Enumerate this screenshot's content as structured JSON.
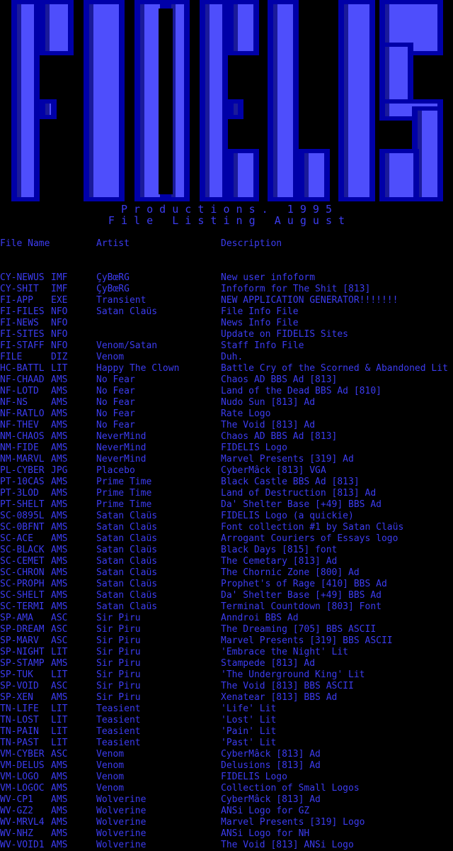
{
  "logo": {
    "text": "FIDELIS",
    "colors": {
      "fill": "#4e4efc",
      "shade": "#1a1a9a",
      "outline": "#0000a8"
    }
  },
  "tagline1": "P r o d u c t i o n s .   1 9 9 5",
  "tagline2": "F i l e   L i s t i n g   A u g u s t",
  "headers": {
    "name": "File Name",
    "artist": "Artist",
    "description": "Description"
  },
  "colors": {
    "text": "#3c3cf0",
    "background": "#000000"
  },
  "files": [
    {
      "name": "CY-NEWUS",
      "ext": "IMF",
      "artist": "ÇyBœRG",
      "desc": "New user infoform"
    },
    {
      "name": "CY-SHIT",
      "ext": "IMF",
      "artist": "ÇyBœRG",
      "desc": "Infoform for The Shit [813]"
    },
    {
      "name": "FI-APP",
      "ext": "EXE",
      "artist": "Transient",
      "desc": "NEW APPLICATION GENERATOR!!!!!!!"
    },
    {
      "name": "FI-FILES",
      "ext": "NFO",
      "artist": "Satan Claüs",
      "desc": "File Info File"
    },
    {
      "name": "FI-NEWS",
      "ext": "NFO",
      "artist": "",
      "desc": "News Info File"
    },
    {
      "name": "FI-SITES",
      "ext": "NFO",
      "artist": "",
      "desc": "Update on FIDELIS Sites"
    },
    {
      "name": "FI-STAFF",
      "ext": "NFO",
      "artist": "Venom/Satan",
      "desc": "Staff Info File"
    },
    {
      "name": "FILE",
      "ext": "DIZ",
      "artist": "Venom",
      "desc": "Duh."
    },
    {
      "name": "HC-BATTL",
      "ext": "LIT",
      "artist": "Happy The Clown",
      "desc": "Battle Cry of the Scorned & Abandoned Lit"
    },
    {
      "name": "NF-CHAAD",
      "ext": "AMS",
      "artist": "No Fear",
      "desc": "Chaos AD BBS Ad [813]"
    },
    {
      "name": "NF-LOTD",
      "ext": "AMS",
      "artist": "No Fear",
      "desc": "Land of the Dead BBS Ad [810]"
    },
    {
      "name": "NF-NS",
      "ext": "AMS",
      "artist": "No Fear",
      "desc": "Nudo Sun [813] Ad"
    },
    {
      "name": "NF-RATLO",
      "ext": "AMS",
      "artist": "No Fear",
      "desc": "Rate Logo"
    },
    {
      "name": "NF-THEV",
      "ext": "AMS",
      "artist": "No Fear",
      "desc": "The Void [813] Ad"
    },
    {
      "name": "NM-CHAOS",
      "ext": "AMS",
      "artist": "NeverMind",
      "desc": "Chaos AD BBS Ad [813]"
    },
    {
      "name": "NM-FIDE",
      "ext": "AMS",
      "artist": "NeverMind",
      "desc": "FIDELIS Logo"
    },
    {
      "name": "NM-MARVL",
      "ext": "AMS",
      "artist": "NeverMind",
      "desc": "Marvel Presents [319] Ad"
    },
    {
      "name": "PL-CYBER",
      "ext": "JPG",
      "artist": "Placebo",
      "desc": "CyberMâck [813] VGA"
    },
    {
      "name": "PT-10CAS",
      "ext": "AMS",
      "artist": "Prime Time",
      "desc": "Black Castle BBS Ad [813]"
    },
    {
      "name": "PT-3LOD",
      "ext": "AMS",
      "artist": "Prime Time",
      "desc": "Land of Destruction [813] Ad"
    },
    {
      "name": "PT-SHELT",
      "ext": "AMS",
      "artist": "Prime Time",
      "desc": "Da' Shelter Base [+49] BBS Ad"
    },
    {
      "name": "SC-0895L",
      "ext": "AMS",
      "artist": "Satan Claüs",
      "desc": "FIDELIS Logo (a quickie)"
    },
    {
      "name": "SC-0BFNT",
      "ext": "AMS",
      "artist": "Satan Claüs",
      "desc": "Font collection #1 by Satan Claüs"
    },
    {
      "name": "SC-ACE",
      "ext": "AMS",
      "artist": "Satan Claüs",
      "desc": "Arrogant Couriers of Essays logo"
    },
    {
      "name": "SC-BLACK",
      "ext": "AMS",
      "artist": "Satan Claüs",
      "desc": "Black Days [815] font"
    },
    {
      "name": "SC-CEMET",
      "ext": "AMS",
      "artist": "Satan Claüs",
      "desc": "The Cemetary [813] Ad"
    },
    {
      "name": "SC-CHRON",
      "ext": "AMS",
      "artist": "Satan Claüs",
      "desc": "The Chornic Zone [800] Ad"
    },
    {
      "name": "SC-PROPH",
      "ext": "AMS",
      "artist": "Satan Claüs",
      "desc": "Prophet's of Rage [410] BBS Ad"
    },
    {
      "name": "SC-SHELT",
      "ext": "AMS",
      "artist": "Satan Claüs",
      "desc": "Da' Shelter Base [+49] BBS Ad"
    },
    {
      "name": "SC-TERMI",
      "ext": "AMS",
      "artist": "Satan Claüs",
      "desc": "Terminal Countdown [803] Font"
    },
    {
      "name": "SP-AMA",
      "ext": "ASC",
      "artist": "Sir Piru",
      "desc": "Anndroi BBS Ad"
    },
    {
      "name": "SP-DREAM",
      "ext": "ASC",
      "artist": "Sir Piru",
      "desc": "The Dreaming [705] BBS ASCII"
    },
    {
      "name": "SP-MARV",
      "ext": "ASC",
      "artist": "Sir Piru",
      "desc": "Marvel Presents [319] BBS ASCII"
    },
    {
      "name": "SP-NIGHT",
      "ext": "LIT",
      "artist": "Sir Piru",
      "desc": "'Embrace the Night' Lit"
    },
    {
      "name": "SP-STAMP",
      "ext": "AMS",
      "artist": "Sir Piru",
      "desc": "Stampede [813] Ad"
    },
    {
      "name": "SP-TUK",
      "ext": "LIT",
      "artist": "Sir Piru",
      "desc": "'The Underground King' Lit"
    },
    {
      "name": "SP-VOID",
      "ext": "ASC",
      "artist": "Sir Piru",
      "desc": "The Void [813] BBS ASCII"
    },
    {
      "name": "SP-XEN",
      "ext": "AMS",
      "artist": "Sir Piru",
      "desc": "Xenatear [813] BBS Ad"
    },
    {
      "name": "TN-LIFE",
      "ext": "LIT",
      "artist": "Teasient",
      "desc": "'Life' Lit"
    },
    {
      "name": "TN-LOST",
      "ext": "LIT",
      "artist": "Teasient",
      "desc": "'Lost' Lit"
    },
    {
      "name": "TN-PAIN",
      "ext": "LIT",
      "artist": "Teasient",
      "desc": "'Pain' Lit"
    },
    {
      "name": "TN-PAST",
      "ext": "LIT",
      "artist": "Teasient",
      "desc": "'Past' Lit"
    },
    {
      "name": "VM-CYBER",
      "ext": "ASC",
      "artist": "Venom",
      "desc": "CyberMâck [813] Ad"
    },
    {
      "name": "VM-DELUS",
      "ext": "AMS",
      "artist": "Venom",
      "desc": "Delusions [813] Ad"
    },
    {
      "name": "VM-LOGO",
      "ext": "AMS",
      "artist": "Venom",
      "desc": "FIDELIS Logo"
    },
    {
      "name": "VM-LOGOC",
      "ext": "AMS",
      "artist": "Venom",
      "desc": "Collection of Small Logos"
    },
    {
      "name": "WV-CP1",
      "ext": "AMS",
      "artist": "Wolverine",
      "desc": "CyberMâck [813] Ad"
    },
    {
      "name": "WV-GZ2",
      "ext": "AMS",
      "artist": "Wolverine",
      "desc": "ANSi Logo for GZ"
    },
    {
      "name": "WV-MRVL4",
      "ext": "AMS",
      "artist": "Wolverine",
      "desc": "Marvel Presents [319] Logo"
    },
    {
      "name": "WV-NHZ",
      "ext": "AMS",
      "artist": "Wolverine",
      "desc": "ANSi Logo for NH"
    },
    {
      "name": "WV-VOID1",
      "ext": "AMS",
      "artist": "Wolverine",
      "desc": "The Void [813] ANSi Logo"
    }
  ]
}
